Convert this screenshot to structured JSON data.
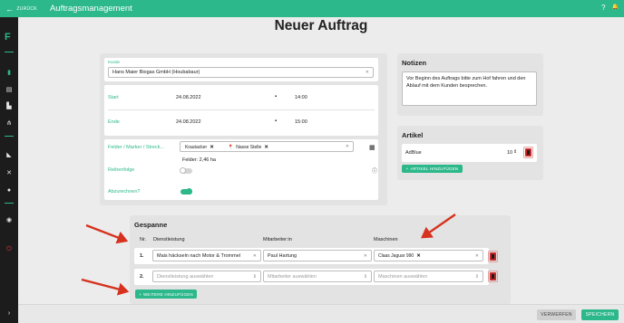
{
  "topbar": {
    "back_label": "ZURÜCK",
    "title": "Auftragsmanagement",
    "help": "?",
    "bell": "🔔"
  },
  "sidebar": {
    "logo": "F"
  },
  "headline": "Neuer Auftrag",
  "form": {
    "kunde_label": "Kunde",
    "kunde_value": "Hans Maier Biogas GmbH (Houbabaur)",
    "start_label": "Start",
    "start_date": "24.08.2022",
    "start_time": "14:00",
    "ende_label": "Ende",
    "ende_date": "24.08.2022",
    "ende_time": "15:00",
    "felder_label": "Felder / Marker / Streck...",
    "felder_chips": [
      "Krautacker",
      "Nasse Stelle"
    ],
    "felder_area": "Felder: 2,46 ha",
    "reihenfolge_label": "Reihenfolge",
    "abzurechnen_label": "Abzurechnen?"
  },
  "notizen": {
    "title": "Notizen",
    "text": "Vor Beginn des Auftrags bitte zum Hof fahren und den Ablauf mit dem Kunden besprechen."
  },
  "artikel": {
    "title": "Artikel",
    "item_name": "AdBlue",
    "item_qty": "10",
    "add_label": "ARTIKEL HINZUFÜGEN"
  },
  "gespanne": {
    "title": "Gespanne",
    "col_nr": "Nr.",
    "col_dienst": "Dienstleistung",
    "col_mitarbeiter": "Mitarbeiter:in",
    "col_maschinen": "Maschinen",
    "rows": [
      {
        "nr": "1.",
        "dienst": "Mais häckseln nach Motor & Trommel",
        "mitarbeiter": "Paul Hartung",
        "maschine": "Claas Jaguar 990"
      },
      {
        "nr": "2.",
        "dienst": "Dienstleistung auswählen",
        "mitarbeiter": "Mitarbeiter auswählen",
        "maschine": "Maschinen auswählen"
      }
    ],
    "add_label": "WEITERE HINZUFÜGEN"
  },
  "footer": {
    "discard_label": "VERWERFEN",
    "save_label": "SPEICHERN"
  },
  "colors": {
    "accent": "#2cb88a",
    "sidebar": "#1c1c1c",
    "danger": "#c62828",
    "arrow": "#d6321f"
  }
}
